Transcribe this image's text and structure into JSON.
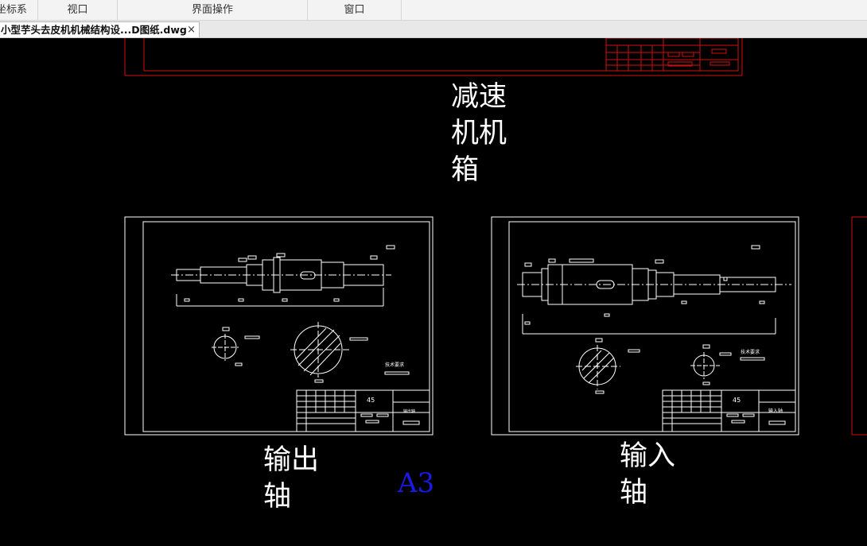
{
  "menubar": {
    "items": [
      {
        "label": "坐标系"
      },
      {
        "label": "视口"
      },
      {
        "label": "界面操作"
      },
      {
        "label": "窗口"
      }
    ]
  },
  "tab": {
    "title": "小型芋头去皮机机械结构设...D图纸.dwg",
    "close": "×"
  },
  "drawing": {
    "background": "#000000",
    "labels": {
      "gearbox": [
        "减速",
        "机机",
        "箱"
      ],
      "output_shaft": [
        "输出",
        "轴"
      ],
      "input_shaft": [
        "输入",
        "轴"
      ],
      "sheet_size": "A3"
    },
    "sheet_output": {
      "material": "45",
      "part_name": "输出轴",
      "tech_note": "技术要求"
    },
    "sheet_input": {
      "material": "45",
      "part_name": "输入轴",
      "tech_note": "技术要求"
    },
    "colors": {
      "frame": "#ffffff",
      "top_sheet": "#d01010",
      "a3_text": "#1a1ae6"
    }
  }
}
